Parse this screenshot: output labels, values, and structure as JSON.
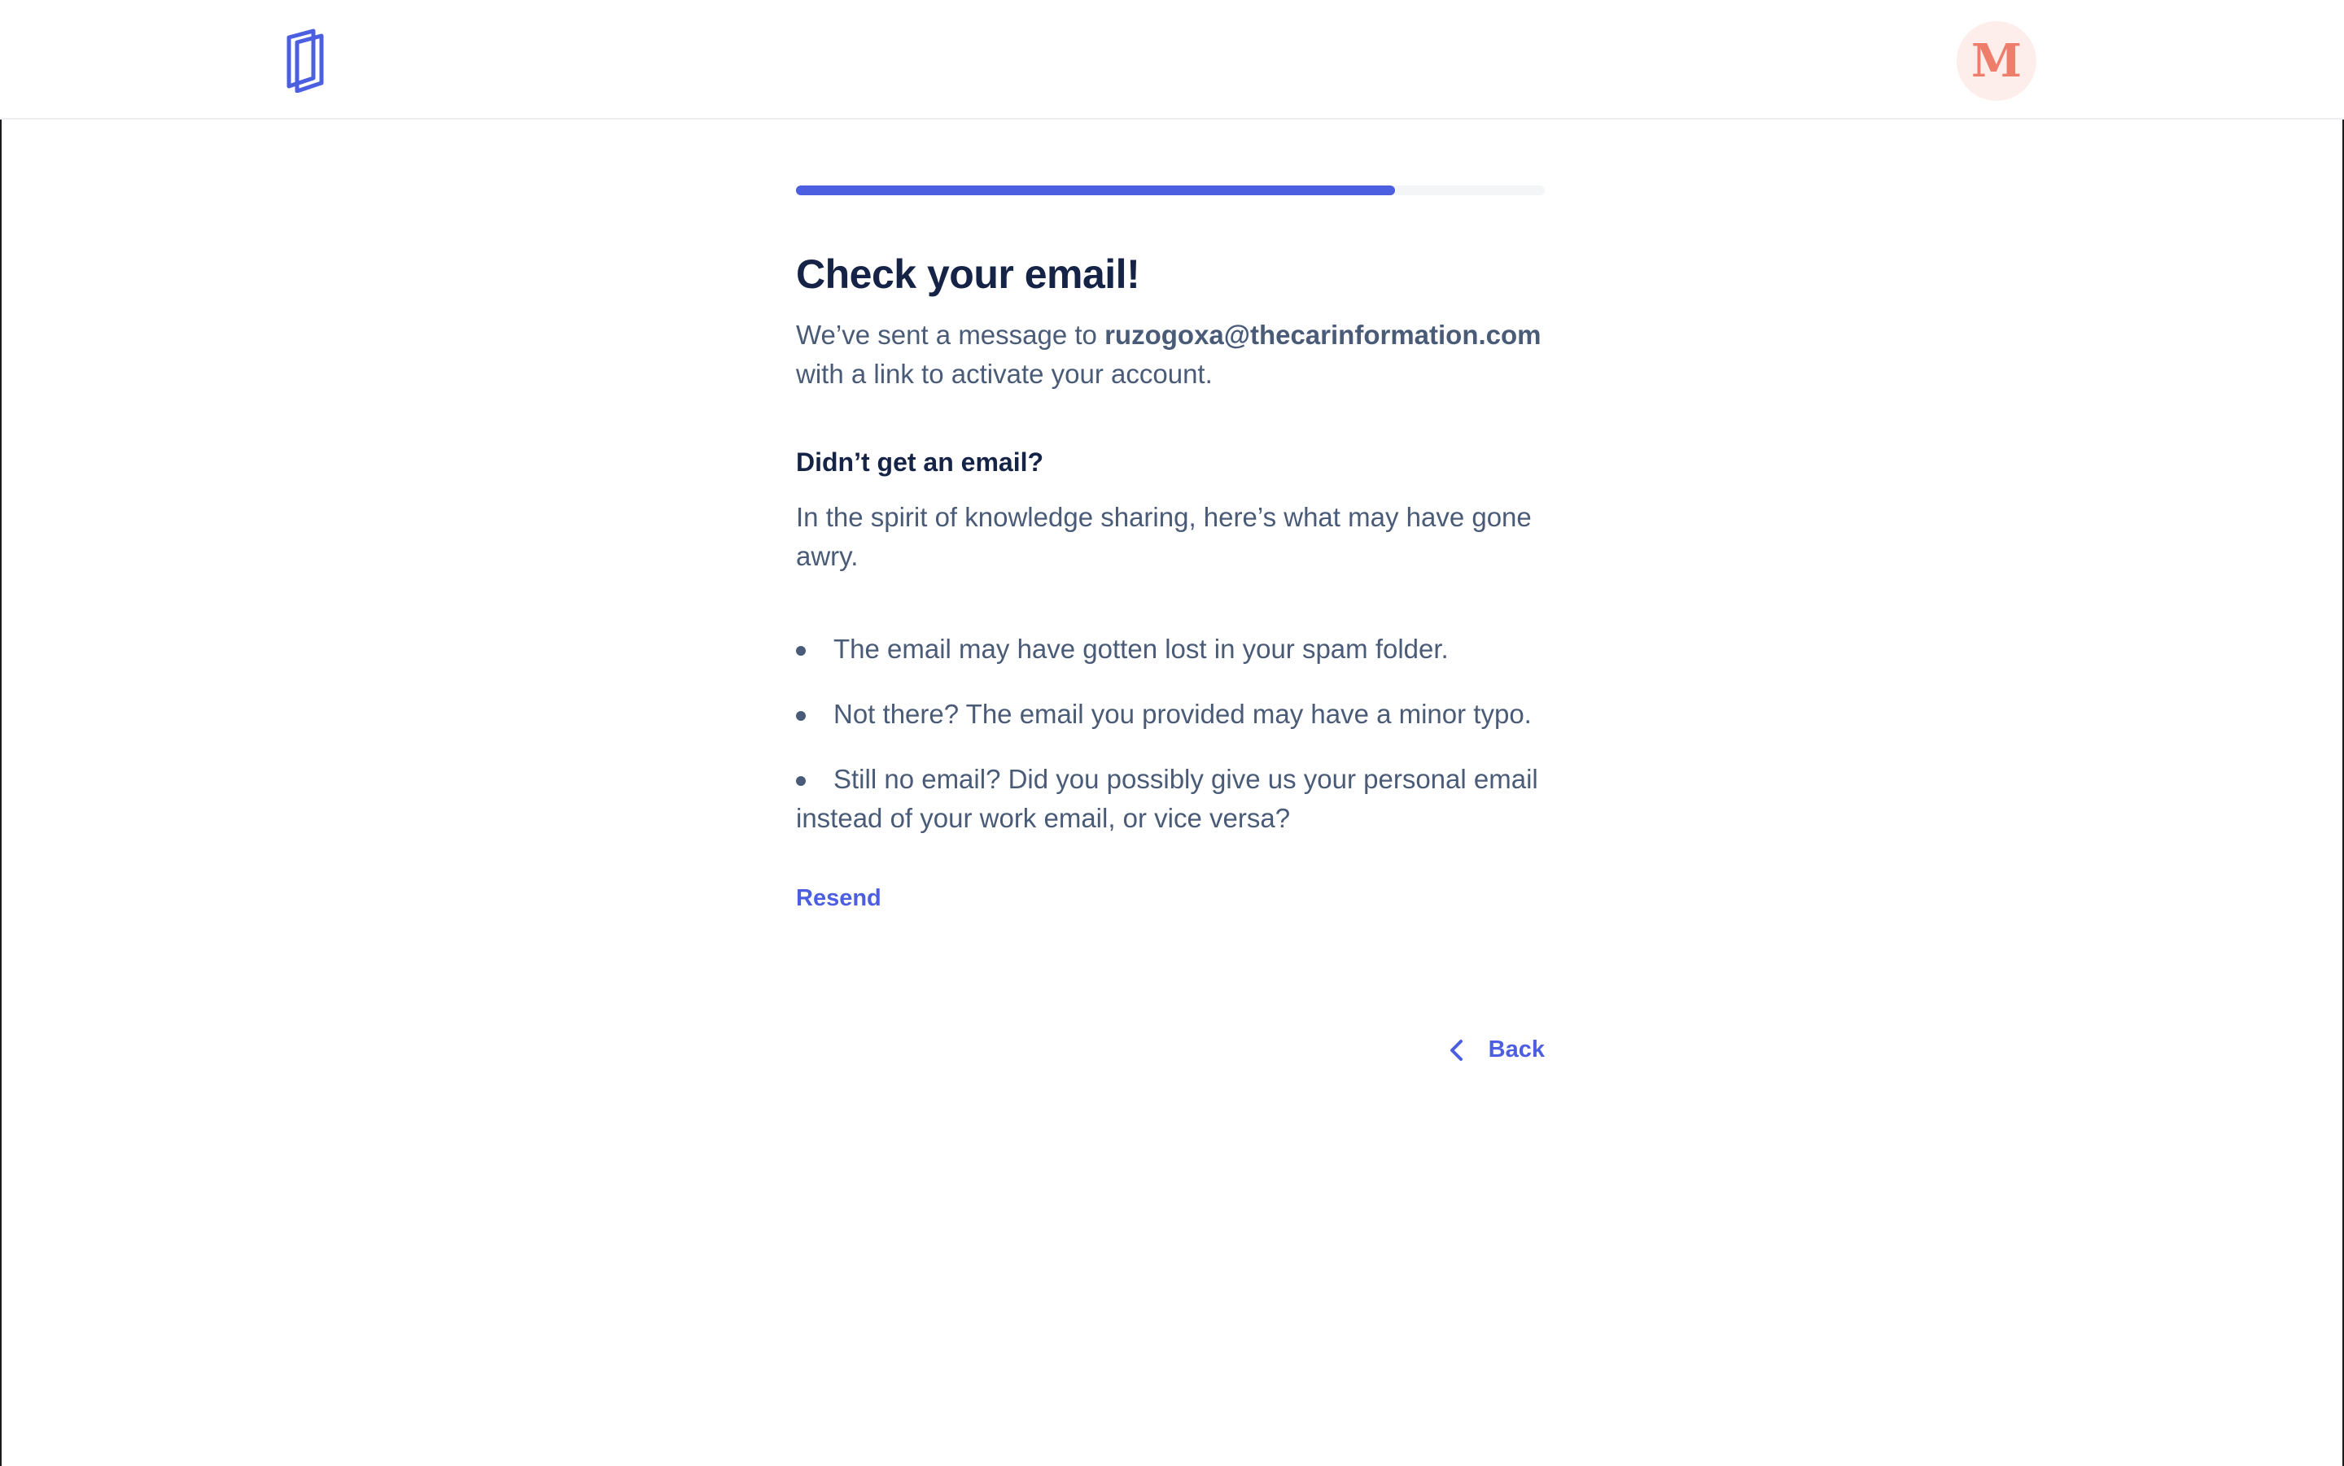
{
  "header": {
    "logo_icon": "book-logo-icon",
    "avatar_initial": "M"
  },
  "progress": {
    "fraction": 0.8
  },
  "content": {
    "title": "Check your email!",
    "message_prefix": "We’ve sent a message to ",
    "email": "ruzogoxa@thecarinformation.com",
    "message_suffix": " with a link to activate your account.",
    "subheading": "Didn’t get an email?",
    "intro": "In the spirit of knowledge sharing, here’s what may have gone awry.",
    "tips": [
      "The email may have gotten lost in your spam folder.",
      "Not there? The email you provided may have a minor typo.",
      "Still no email? Did you possibly give us your personal email instead of your work email, or vice versa?"
    ],
    "resend_label": "Resend",
    "back_label": "Back",
    "back_icon": "chevron-left-icon"
  },
  "colors": {
    "accent": "#4c5fe0",
    "avatar_bg": "#fdeeec",
    "avatar_text": "#ef7d6b",
    "heading": "#152347",
    "body": "#4a5b78"
  }
}
